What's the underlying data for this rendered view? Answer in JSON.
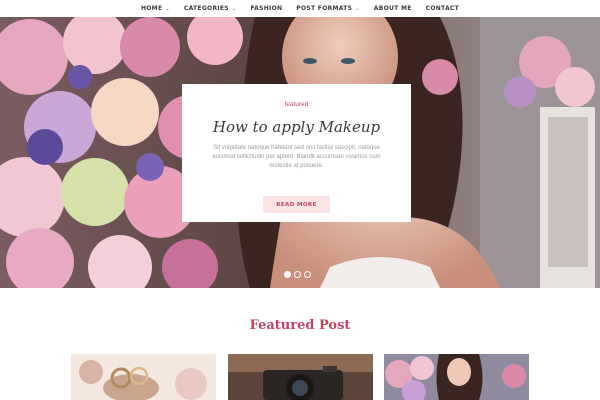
{
  "nav": {
    "items": [
      {
        "label": "HOME",
        "dropdown": true
      },
      {
        "label": "CATEGORIES",
        "dropdown": true
      },
      {
        "label": "FASHION",
        "dropdown": false
      },
      {
        "label": "POST FORMATS",
        "dropdown": true
      },
      {
        "label": "ABOUT ME",
        "dropdown": false
      },
      {
        "label": "CONTACT",
        "dropdown": false
      }
    ],
    "caret_glyph": "⌄"
  },
  "slider": {
    "category": "featured",
    "title": "How to apply Makeup",
    "excerpt": "Sit vulputate natoque habitant sed orci facilisi suscipit, natoque euismod sollicitudin per aptent. Blandit accumsan vivamus cum molestie at posuere.",
    "button_label": "READ MORE",
    "slides_total": 3,
    "active_slide": 1
  },
  "featured": {
    "heading": "Featured Post",
    "posts": [
      {
        "image": "wedding-rings-photo"
      },
      {
        "image": "camera-photo"
      },
      {
        "image": "woman-flowers-photo"
      }
    ]
  },
  "colors": {
    "accent": "#c2445e",
    "button_bg": "#fbe3e6",
    "text_dark": "#3a3a3a",
    "text_muted": "#9a9a9a"
  }
}
